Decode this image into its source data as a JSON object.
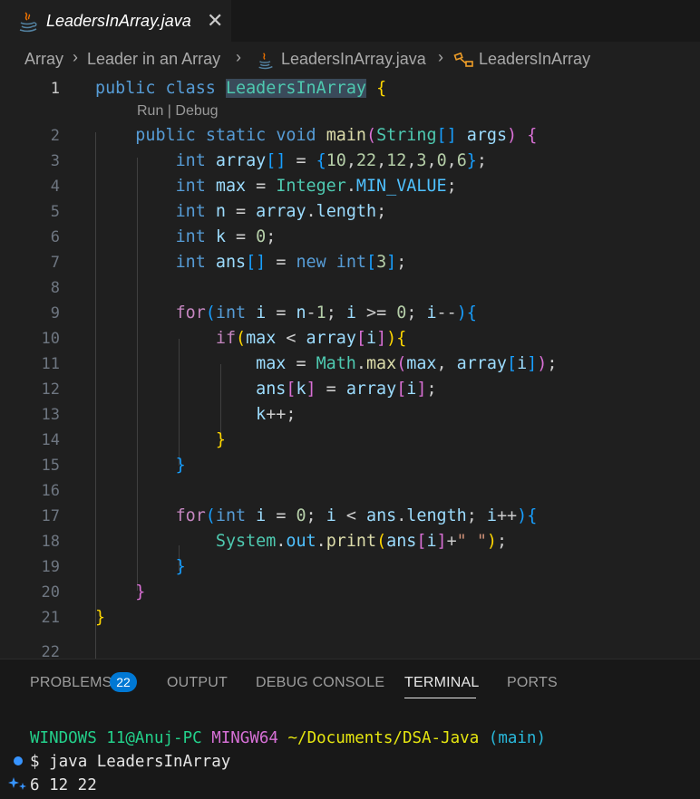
{
  "tab": {
    "title": "LeadersInArray.java",
    "close": "✕"
  },
  "breadcrumb": {
    "items": [
      "Array",
      "Leader in an Array",
      "LeadersInArray.java",
      "LeadersInArray"
    ],
    "separator": "›"
  },
  "codelens": "Run | Debug",
  "line_numbers": [
    "1",
    "2",
    "3",
    "4",
    "5",
    "6",
    "7",
    "8",
    "9",
    "10",
    "11",
    "12",
    "13",
    "14",
    "15",
    "16",
    "17",
    "18",
    "19",
    "20",
    "21",
    "22"
  ],
  "code": {
    "l1": {
      "kw1": "public",
      "kw2": "class",
      "name": "LeadersInArray",
      "brace": "{"
    },
    "l2": {
      "kw1": "public",
      "kw2": "static",
      "kw3": "void",
      "fn": "main",
      "p1": "(",
      "type": "String",
      "arr": "[]",
      "arg": "args",
      "p2": ")",
      "brace": "{"
    },
    "l3": {
      "type": "int",
      "var": "array",
      "arr": "[]",
      "eq": " = ",
      "open": "{",
      "nums": [
        "10",
        "22",
        "12",
        "3",
        "0",
        "6"
      ],
      "comma": ",",
      "close": "}",
      "semi": ";"
    },
    "l4": {
      "type": "int",
      "var": "max",
      "eq": " = ",
      "cls": "Integer",
      "dot": ".",
      "const": "MIN_VALUE",
      "semi": ";"
    },
    "l5": {
      "type": "int",
      "var": "n",
      "eq": " = ",
      "obj": "array",
      "dot": ".",
      "prop": "length",
      "semi": ";"
    },
    "l6": {
      "type": "int",
      "var": "k",
      "eq": " = ",
      "num": "0",
      "semi": ";"
    },
    "l7": {
      "type": "int",
      "var": "ans",
      "arr": "[]",
      "eq": " = ",
      "kw": "new",
      "type2": "int",
      "open": "[",
      "num": "3",
      "close": "]",
      "semi": ";"
    },
    "l9": {
      "kw": "for",
      "p1": "(",
      "type": "int",
      "v1": "i",
      "eq": " = ",
      "v2": "n",
      "minus": "-",
      "num1": "1",
      "semi1": "; ",
      "v3": "i",
      "op": " >= ",
      "num2": "0",
      "semi2": "; ",
      "v4": "i",
      "dec": "--",
      "p2": ")",
      "brace": "{"
    },
    "l10": {
      "kw": "if",
      "p1": "(",
      "v1": "max",
      "op": " < ",
      "v2": "array",
      "b1": "[",
      "v3": "i",
      "b2": "]",
      "p2": ")",
      "brace": "{"
    },
    "l11": {
      "v1": "max",
      "eq": " = ",
      "cls": "Math",
      "dot": ".",
      "fn": "max",
      "p1": "(",
      "a1": "max",
      "comma": ", ",
      "a2": "array",
      "b1": "[",
      "a3": "i",
      "b2": "]",
      "p2": ")",
      "semi": ";"
    },
    "l12": {
      "v1": "ans",
      "b1": "[",
      "v2": "k",
      "b2": "]",
      "eq": " = ",
      "v3": "array",
      "b3": "[",
      "v4": "i",
      "b4": "]",
      "semi": ";"
    },
    "l13": {
      "v1": "k",
      "inc": "++",
      "semi": ";"
    },
    "l14": {
      "brace": "}"
    },
    "l15": {
      "brace": "}"
    },
    "l17": {
      "kw": "for",
      "p1": "(",
      "type": "int",
      "v1": "i",
      "eq": " = ",
      "num": "0",
      "semi1": "; ",
      "v2": "i",
      "op": " < ",
      "v3": "ans",
      "dot": ".",
      "prop": "length",
      "semi2": "; ",
      "v4": "i",
      "inc": "++",
      "p2": ")",
      "brace": "{"
    },
    "l18": {
      "cls": "System",
      "dot1": ".",
      "field": "out",
      "dot2": ".",
      "fn": "print",
      "p1": "(",
      "v1": "ans",
      "b1": "[",
      "v2": "i",
      "b2": "]",
      "plus": "+",
      "str": "\" \"",
      "p2": ")",
      "semi": ";"
    },
    "l19": {
      "brace": "}"
    },
    "l20": {
      "brace": "}"
    },
    "l21": {
      "brace": "}"
    }
  },
  "panel": {
    "tabs": [
      "PROBLEMS",
      "OUTPUT",
      "DEBUG CONSOLE",
      "TERMINAL",
      "PORTS"
    ],
    "problems_count": "22",
    "active_tab": "TERMINAL"
  },
  "terminal": {
    "user": "WINDOWS 11@Anuj-PC",
    "shell": "MINGW64",
    "path": "~/Documents/DSA-Java",
    "branch": "(main)",
    "prompt": "$",
    "command": "java LeadersInArray",
    "output": "6 12 22"
  }
}
